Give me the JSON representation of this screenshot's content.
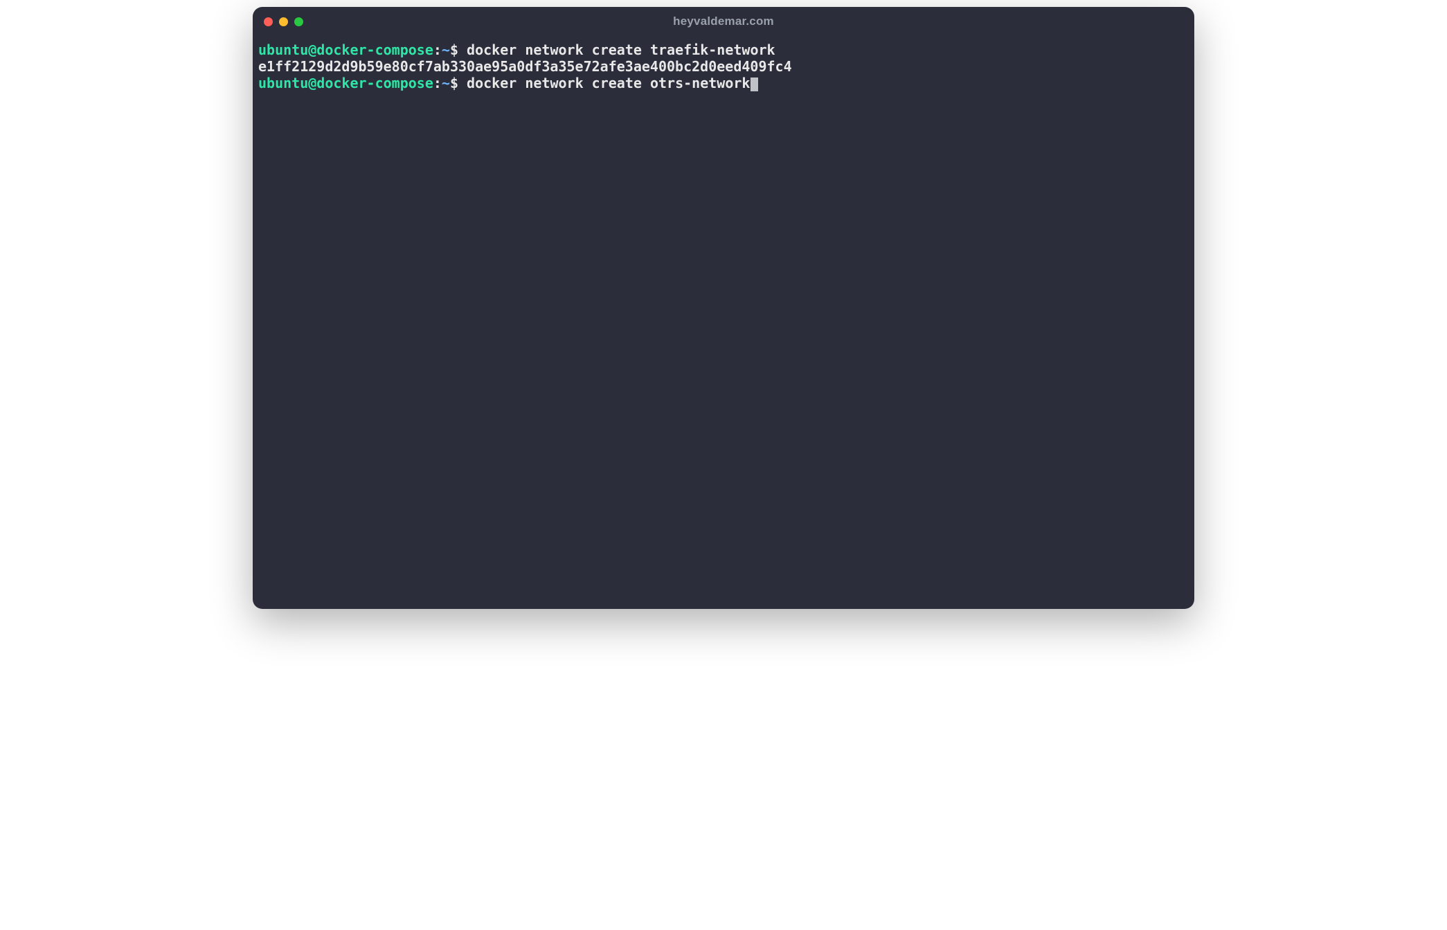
{
  "window": {
    "title": "heyvaldemar.com"
  },
  "prompt": {
    "user_host": "ubuntu@docker-compose",
    "colon": ":",
    "path": "~",
    "symbol": "$"
  },
  "lines": [
    {
      "type": "command",
      "command": " docker network create traefik-network"
    },
    {
      "type": "output",
      "text": "e1ff2129d2d9b59e80cf7ab330ae95a0df3a35e72afe3ae400bc2d0eed409fc4"
    },
    {
      "type": "command_with_cursor",
      "command": " docker network create otrs-network"
    }
  ],
  "colors": {
    "background": "#2b2d3a",
    "prompt_user": "#2ee6a6",
    "prompt_path": "#6fb3ff",
    "text": "#e8e8e8",
    "title": "#9aa0ab"
  }
}
